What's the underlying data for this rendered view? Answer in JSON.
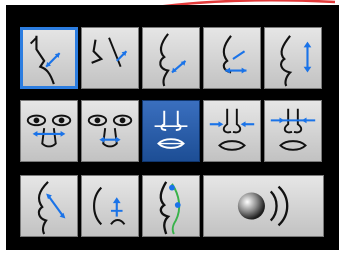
{
  "toolbar": {
    "rows": [
      {
        "tools": [
          {
            "icon": "nose-bridge-diagonal-icon",
            "selected": true
          },
          {
            "icon": "nose-tip-lift-icon"
          },
          {
            "icon": "nose-profile-tip-icon"
          },
          {
            "icon": "nose-width-icon"
          },
          {
            "icon": "nose-length-vertical-icon"
          }
        ]
      },
      {
        "tools": [
          {
            "icon": "eyes-nose-width-icon"
          },
          {
            "icon": "eyes-nose-narrow-icon"
          },
          {
            "icon": "nostril-lips-icon",
            "active": true
          },
          {
            "icon": "nose-lips-left-icon"
          },
          {
            "icon": "nose-lips-right-icon"
          }
        ]
      },
      {
        "tools": [
          {
            "icon": "profile-diagonal-icon"
          },
          {
            "icon": "profile-chin-vertical-icon"
          },
          {
            "icon": "profile-curve-green-icon"
          },
          {
            "icon": "sound-wave-icon"
          }
        ]
      }
    ]
  },
  "colors": {
    "panel": "#000000",
    "button": "#d4d4d4",
    "active": "#2b5ea8",
    "outline": "#2c7de0",
    "annotation_arrow": "#e23b3b",
    "icon_arrow": "#1a73e8",
    "profile_curve": "#38b24a"
  }
}
